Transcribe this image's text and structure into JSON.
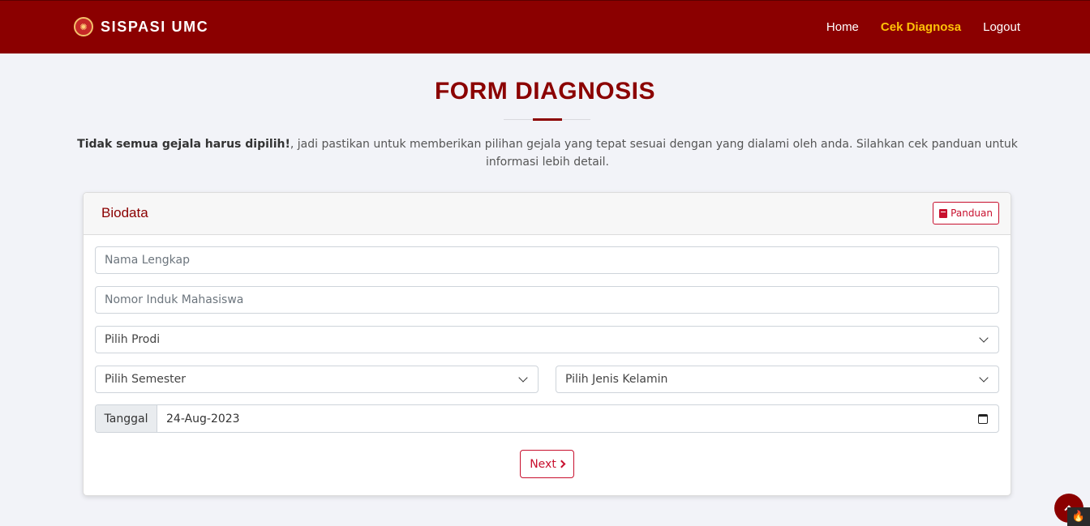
{
  "brand": {
    "name": "SISPASI UMC",
    "logo_icon": "university-seal-icon"
  },
  "nav": {
    "home": "Home",
    "cek_diagnosa": "Cek Diagnosa",
    "logout": "Logout",
    "active_color": "#ffc107"
  },
  "page": {
    "title": "FORM DIAGNOSIS",
    "intro_bold": "Tidak semua gejala harus dipilih!",
    "intro_rest": ", jadi pastikan untuk memberikan pilihan gejala yang tepat sesuai dengan yang dialami oleh anda. Silahkan cek panduan untuk informasi lebih detail."
  },
  "card": {
    "title": "Biodata",
    "panduan_label": "Panduan",
    "fields": {
      "nama_placeholder": "Nama Lengkap",
      "nim_placeholder": "Nomor Induk Mahasiswa",
      "prodi_selected": "Pilih Prodi",
      "semester_selected": "Pilih Semester",
      "jenis_kelamin_selected": "Pilih Jenis Kelamin",
      "tanggal_label": "Tanggal",
      "tanggal_value": "24-Aug-2023"
    },
    "next_label": "Next"
  },
  "colors": {
    "brand": "#8b0000",
    "accent": "#c8102e",
    "background": "#f2f3f8"
  }
}
